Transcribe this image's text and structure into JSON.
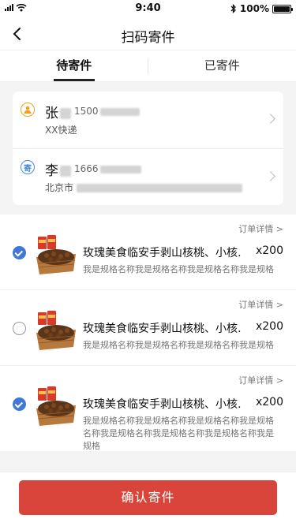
{
  "status_bar": {
    "time": "9:40",
    "battery": "100%",
    "battery_level": 1.0
  },
  "nav": {
    "title": "扫码寄件",
    "back_icon": "chevron-left-icon"
  },
  "tabs": [
    {
      "label": "待寄件",
      "active": true
    },
    {
      "label": "已寄件",
      "active": false
    }
  ],
  "sender": {
    "icon": "person-icon",
    "name": "张",
    "phone_prefix": "1500",
    "sub": "XX快递"
  },
  "receiver": {
    "icon_text": "寄",
    "name": "李",
    "phone_prefix": "1666",
    "address_prefix": "北京市"
  },
  "orders": [
    {
      "detail_link": "订单详情 >",
      "checked": true,
      "name": "玫瑰美食临安手剥山核桃、小核…",
      "qty": "x200",
      "spec": "我是规格名称我是规格名称我是规格名称我是规格"
    },
    {
      "detail_link": "订单详情 >",
      "checked": false,
      "name": "玫瑰美食临安手剥山核桃、小核…",
      "qty": "x200",
      "spec": "我是规格名称我是规格名称我是规格名称我是规格"
    },
    {
      "detail_link": "订单详情 >",
      "checked": true,
      "name": "玫瑰美食临安手剥山核桃、小核…",
      "qty": "x200",
      "spec": "我是规格名称我是规格名称我是规格名称我是规格名称我是规格名称我是规格名称我是规格名称我是规格"
    }
  ],
  "confirm_button": "确认寄件",
  "colors": {
    "accent": "#d9453b",
    "check": "#3f78d6"
  }
}
